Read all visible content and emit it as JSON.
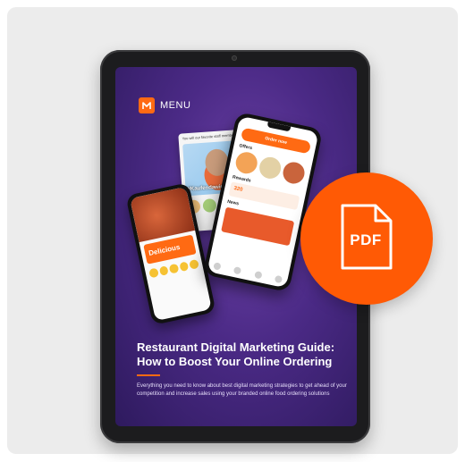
{
  "brand": {
    "name": "MENU",
    "icon": "menu-logo-icon",
    "accent": "#ff6a13"
  },
  "mockups": {
    "promo_card": {
      "header": "You will our favorite staff members",
      "tag": "#Kaufendawigtes"
    },
    "left_phone": {
      "banner": "Delicious"
    },
    "right_phone": {
      "order_button": "Order now",
      "offers_label": "Offers",
      "rewards_label": "Rewards",
      "reward_points": "320",
      "news_label": "News"
    }
  },
  "guide": {
    "title": "Restaurant Digital Marketing Guide: How to Boost Your Online Ordering",
    "description": "Everything you need to know about best digital marketing strategies to get ahead of your competition and increase sales using your branded online food ordering solutions"
  },
  "badge": {
    "label": "PDF",
    "icon": "pdf-file-icon",
    "color": "#ff5a05"
  }
}
